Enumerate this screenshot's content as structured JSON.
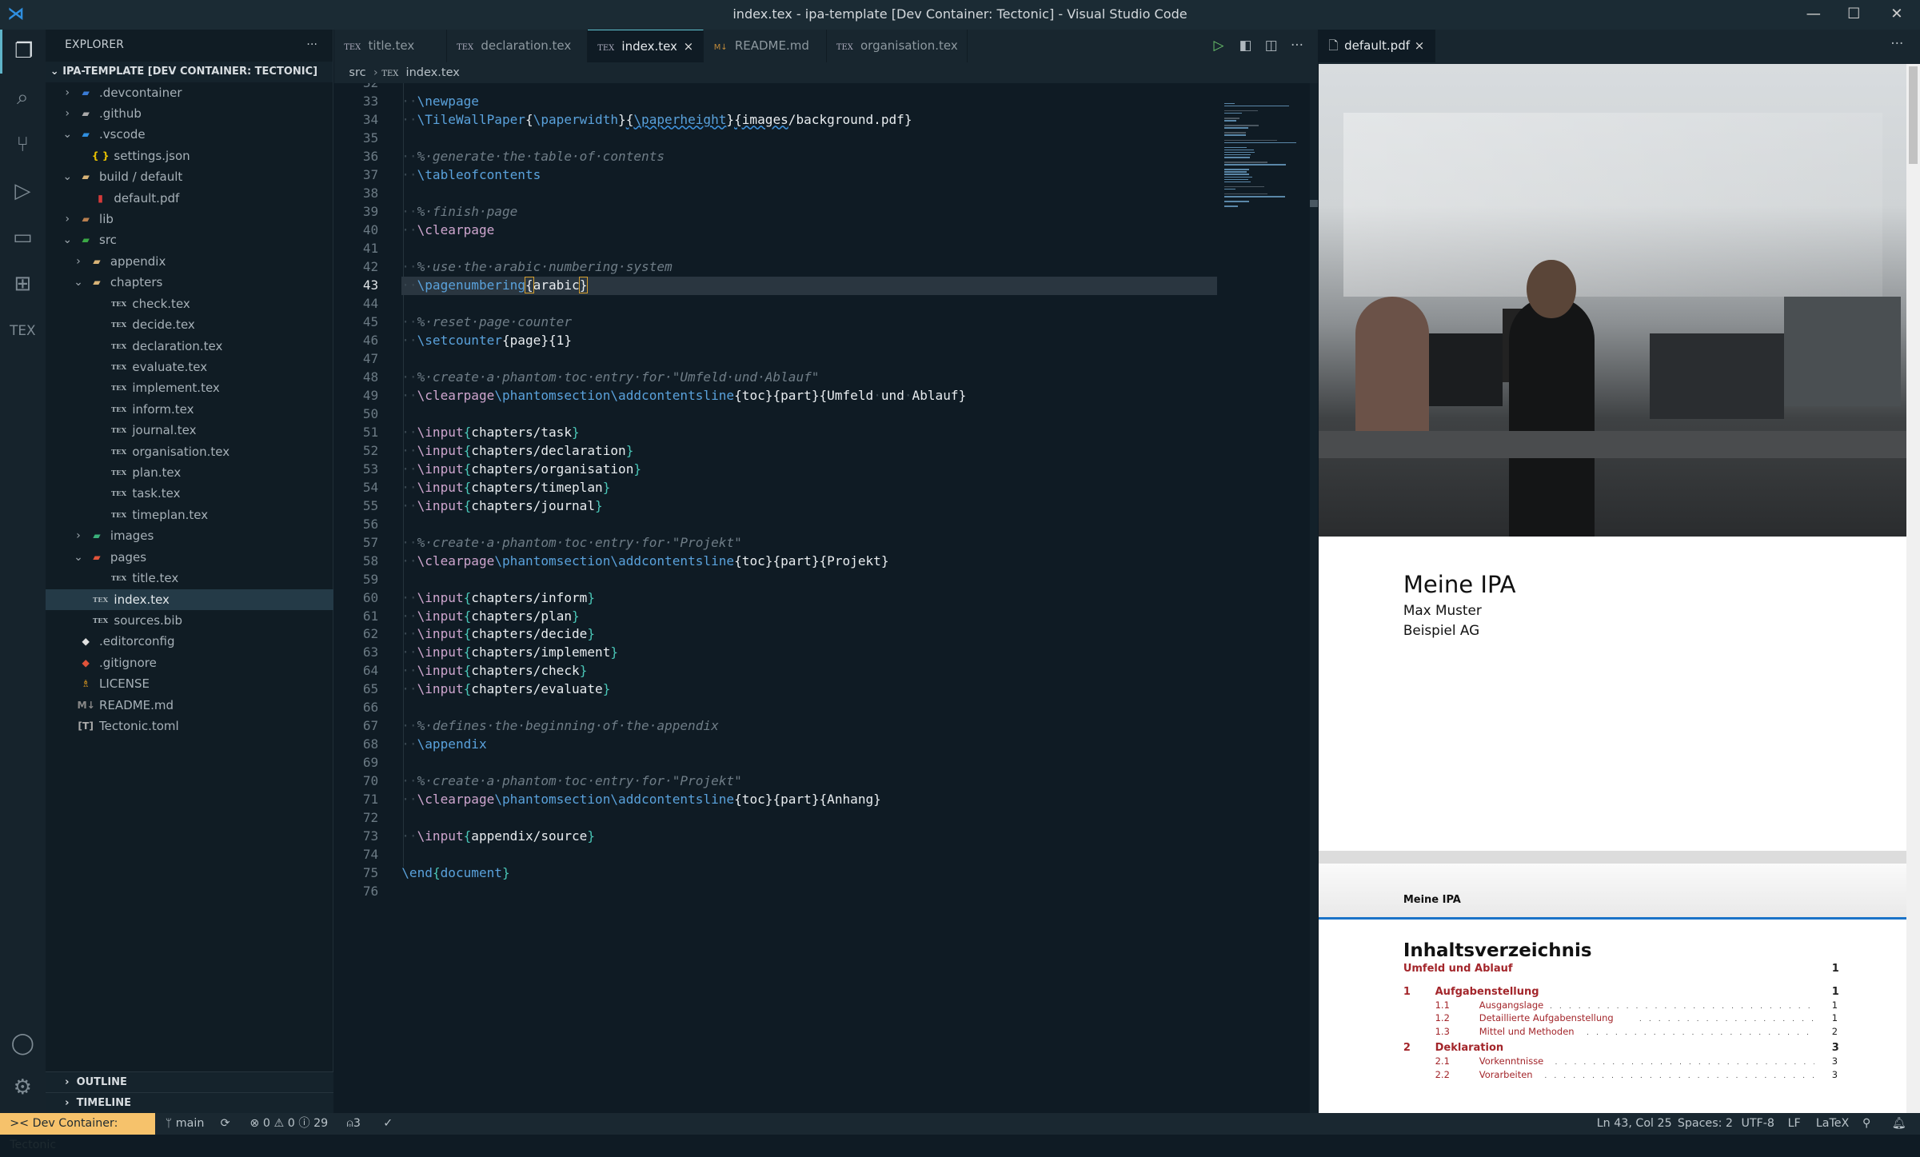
{
  "window": {
    "title": "index.tex - ipa-template [Dev Container: Tectonic] - Visual Studio Code"
  },
  "activity": [
    "files-icon",
    "search-icon",
    "source-control-icon",
    "run-debug-icon",
    "remote-explorer-icon",
    "extensions-icon",
    "tex-icon",
    "account-icon",
    "settings-gear-icon"
  ],
  "activity_tex_label": "TEX",
  "sidebar": {
    "title": "EXPLORER",
    "more": "···",
    "root": "IPA-TEMPLATE [DEV CONTAINER: TECTONIC]",
    "items": [
      {
        "label": ".devcontainer",
        "depth": 1,
        "chev": "right",
        "icon": "devcontainer-folder-icon",
        "color": "#3a7bd5"
      },
      {
        "label": ".github",
        "depth": 1,
        "chev": "right",
        "icon": "github-folder-icon",
        "color": "#aaaaaa"
      },
      {
        "label": ".vscode",
        "depth": 1,
        "chev": "down",
        "icon": "vscode-folder-icon",
        "color": "#2f8fe0"
      },
      {
        "label": "settings.json",
        "depth": 2,
        "icon": "json-icon",
        "color": "#e8c100",
        "glyph": "{ }"
      },
      {
        "label": "build / default",
        "depth": 1,
        "chev": "down",
        "icon": "folder-open-icon",
        "color": "#d8b377"
      },
      {
        "label": "default.pdf",
        "depth": 2,
        "icon": "pdf-icon",
        "color": "#d63a3a"
      },
      {
        "label": "lib",
        "depth": 1,
        "chev": "right",
        "icon": "lib-folder-icon",
        "color": "#b97f4f"
      },
      {
        "label": "src",
        "depth": 1,
        "chev": "down",
        "icon": "src-folder-icon",
        "color": "#3aa845"
      },
      {
        "label": "appendix",
        "depth": 2,
        "chev": "right",
        "icon": "folder-icon",
        "color": "#d8b377"
      },
      {
        "label": "chapters",
        "depth": 2,
        "chev": "down",
        "icon": "folder-open-icon",
        "color": "#d8b377"
      },
      {
        "label": "check.tex",
        "depth": 3,
        "icon": "tex-file-icon"
      },
      {
        "label": "decide.tex",
        "depth": 3,
        "icon": "tex-file-icon"
      },
      {
        "label": "declaration.tex",
        "depth": 3,
        "icon": "tex-file-icon"
      },
      {
        "label": "evaluate.tex",
        "depth": 3,
        "icon": "tex-file-icon"
      },
      {
        "label": "implement.tex",
        "depth": 3,
        "icon": "tex-file-icon"
      },
      {
        "label": "inform.tex",
        "depth": 3,
        "icon": "tex-file-icon"
      },
      {
        "label": "journal.tex",
        "depth": 3,
        "icon": "tex-file-icon"
      },
      {
        "label": "organisation.tex",
        "depth": 3,
        "icon": "tex-file-icon"
      },
      {
        "label": "plan.tex",
        "depth": 3,
        "icon": "tex-file-icon"
      },
      {
        "label": "task.tex",
        "depth": 3,
        "icon": "tex-file-icon"
      },
      {
        "label": "timeplan.tex",
        "depth": 3,
        "icon": "tex-file-icon"
      },
      {
        "label": "images",
        "depth": 2,
        "chev": "right",
        "icon": "images-folder-icon",
        "color": "#3ab07a"
      },
      {
        "label": "pages",
        "depth": 2,
        "chev": "down",
        "icon": "pages-folder-icon",
        "color": "#e0533a"
      },
      {
        "label": "title.tex",
        "depth": 3,
        "icon": "tex-file-icon"
      },
      {
        "label": "index.tex",
        "depth": 2,
        "icon": "tex-file-icon",
        "selected": true
      },
      {
        "label": "sources.bib",
        "depth": 2,
        "icon": "bib-file-icon"
      },
      {
        "label": ".editorconfig",
        "depth": 1,
        "icon": "editorconfig-icon",
        "color": "#e0e0e0"
      },
      {
        "label": ".gitignore",
        "depth": 1,
        "icon": "git-icon",
        "color": "#e0533a"
      },
      {
        "label": "LICENSE",
        "depth": 1,
        "icon": "license-icon",
        "color": "#e8a020"
      },
      {
        "label": "README.md",
        "depth": 1,
        "icon": "markdown-icon",
        "color": "#888888"
      },
      {
        "label": "Tectonic.toml",
        "depth": 1,
        "icon": "toml-icon",
        "color": "#aaaaaa"
      }
    ],
    "panels": [
      "OUTLINE",
      "TIMELINE"
    ]
  },
  "editor": {
    "tabs": [
      {
        "label": "title.tex",
        "icon": "tex-file-icon"
      },
      {
        "label": "declaration.tex",
        "icon": "tex-file-icon"
      },
      {
        "label": "index.tex",
        "icon": "tex-file-icon",
        "active": true
      },
      {
        "label": "README.md",
        "icon": "markdown-icon"
      },
      {
        "label": "organisation.tex",
        "icon": "tex-file-icon"
      }
    ],
    "tab_icon_text": "TEX",
    "md_icon_text": "M↓",
    "close": "×",
    "actions": [
      "run-icon",
      "open-preview-icon",
      "split-editor-icon",
      "more-icon"
    ],
    "breadcrumb": [
      "src",
      "index.tex"
    ],
    "first_line": 32,
    "current_line": 43,
    "lines": [
      [],
      [
        [
          "ws",
          "··"
        ],
        [
          "cmd",
          "\\newpage"
        ]
      ],
      [
        [
          "ws",
          "··"
        ],
        [
          "cmd",
          "\\TileWallPaper"
        ],
        [
          "br",
          "{"
        ],
        [
          "cmd",
          "\\paperwidth"
        ],
        [
          "br",
          "}"
        ],
        [
          "sq",
          "{"
        ],
        [
          "sqc",
          "\\paperheight"
        ],
        [
          "br",
          "}"
        ],
        [
          "sqt",
          "{images"
        ],
        [
          "txt",
          "/background.pdf}"
        ]
      ],
      [],
      [
        [
          "ws",
          "··"
        ],
        [
          "cm",
          "%·generate·the·table·of·contents"
        ]
      ],
      [
        [
          "ws",
          "··"
        ],
        [
          "cmd",
          "\\tableofcontents"
        ]
      ],
      [],
      [
        [
          "ws",
          "··"
        ],
        [
          "cm",
          "%·finish·page"
        ]
      ],
      [
        [
          "ws",
          "··"
        ],
        [
          "pink",
          "\\clearpage"
        ]
      ],
      [],
      [
        [
          "ws",
          "··"
        ],
        [
          "cm",
          "%·use·the·arabic·numbering·system"
        ]
      ],
      [
        [
          "ws",
          "··"
        ],
        [
          "cmd",
          "\\pagenumbering"
        ],
        [
          "bm",
          "{"
        ],
        [
          "txt",
          "arabic"
        ],
        [
          "bm",
          "}"
        ]
      ],
      [],
      [
        [
          "ws",
          "··"
        ],
        [
          "cm",
          "%·reset·page·counter"
        ]
      ],
      [
        [
          "ws",
          "··"
        ],
        [
          "cmd",
          "\\setcounter"
        ],
        [
          "txt",
          "{page}{1}"
        ]
      ],
      [],
      [
        [
          "ws",
          "··"
        ],
        [
          "cm",
          "%·create·a·phantom·toc·entry·for·\"Umfeld·und·Ablauf\""
        ]
      ],
      [
        [
          "ws",
          "··"
        ],
        [
          "pink",
          "\\clearpage"
        ],
        [
          "cmd",
          "\\phantomsection\\addcontentsline"
        ],
        [
          "txt",
          "{toc}{part}{Umfeld"
        ],
        [
          "ws",
          "·"
        ],
        [
          "txt",
          "und"
        ],
        [
          "ws",
          "·"
        ],
        [
          "txt",
          "Ablauf}"
        ]
      ],
      [],
      [
        [
          "ws",
          "··"
        ],
        [
          "pink",
          "\\input"
        ],
        [
          "tb",
          "{"
        ],
        [
          "txt",
          "chapters/task"
        ],
        [
          "tb",
          "}"
        ]
      ],
      [
        [
          "ws",
          "··"
        ],
        [
          "pink",
          "\\input"
        ],
        [
          "tb",
          "{"
        ],
        [
          "txt",
          "chapters/declaration"
        ],
        [
          "tb",
          "}"
        ]
      ],
      [
        [
          "ws",
          "··"
        ],
        [
          "pink",
          "\\input"
        ],
        [
          "tb",
          "{"
        ],
        [
          "txt",
          "chapters/organisation"
        ],
        [
          "tb",
          "}"
        ]
      ],
      [
        [
          "ws",
          "··"
        ],
        [
          "pink",
          "\\input"
        ],
        [
          "tb",
          "{"
        ],
        [
          "txt",
          "chapters/timeplan"
        ],
        [
          "tb",
          "}"
        ]
      ],
      [
        [
          "ws",
          "··"
        ],
        [
          "pink",
          "\\input"
        ],
        [
          "tb",
          "{"
        ],
        [
          "txt",
          "chapters/journal"
        ],
        [
          "tb",
          "}"
        ]
      ],
      [],
      [
        [
          "ws",
          "··"
        ],
        [
          "cm",
          "%·create·a·phantom·toc·entry·for·\"Projekt\""
        ]
      ],
      [
        [
          "ws",
          "··"
        ],
        [
          "pink",
          "\\clearpage"
        ],
        [
          "cmd",
          "\\phantomsection\\addcontentsline"
        ],
        [
          "txt",
          "{toc}{part}{Projekt}"
        ]
      ],
      [],
      [
        [
          "ws",
          "··"
        ],
        [
          "pink",
          "\\input"
        ],
        [
          "tb",
          "{"
        ],
        [
          "txt",
          "chapters/inform"
        ],
        [
          "tb",
          "}"
        ]
      ],
      [
        [
          "ws",
          "··"
        ],
        [
          "pink",
          "\\input"
        ],
        [
          "tb",
          "{"
        ],
        [
          "txt",
          "chapters/plan"
        ],
        [
          "tb",
          "}"
        ]
      ],
      [
        [
          "ws",
          "··"
        ],
        [
          "pink",
          "\\input"
        ],
        [
          "tb",
          "{"
        ],
        [
          "txt",
          "chapters/decide"
        ],
        [
          "tb",
          "}"
        ]
      ],
      [
        [
          "ws",
          "··"
        ],
        [
          "pink",
          "\\input"
        ],
        [
          "tb",
          "{"
        ],
        [
          "txt",
          "chapters/implement"
        ],
        [
          "tb",
          "}"
        ]
      ],
      [
        [
          "ws",
          "··"
        ],
        [
          "pink",
          "\\input"
        ],
        [
          "tb",
          "{"
        ],
        [
          "txt",
          "chapters/check"
        ],
        [
          "tb",
          "}"
        ]
      ],
      [
        [
          "ws",
          "··"
        ],
        [
          "pink",
          "\\input"
        ],
        [
          "tb",
          "{"
        ],
        [
          "txt",
          "chapters/evaluate"
        ],
        [
          "tb",
          "}"
        ]
      ],
      [],
      [
        [
          "ws",
          "··"
        ],
        [
          "cm",
          "%·defines·the·beginning·of·the·appendix"
        ]
      ],
      [
        [
          "ws",
          "··"
        ],
        [
          "cmd",
          "\\appendix"
        ]
      ],
      [],
      [
        [
          "ws",
          "··"
        ],
        [
          "cm",
          "%·create·a·phantom·toc·entry·for·\"Projekt\""
        ]
      ],
      [
        [
          "ws",
          "··"
        ],
        [
          "pink",
          "\\clearpage"
        ],
        [
          "cmd",
          "\\phantomsection\\addcontentsline"
        ],
        [
          "txt",
          "{toc}{part}{Anhang}"
        ]
      ],
      [],
      [
        [
          "ws",
          "··"
        ],
        [
          "pink",
          "\\input"
        ],
        [
          "tb",
          "{"
        ],
        [
          "txt",
          "appendix/source"
        ],
        [
          "tb",
          "}"
        ]
      ],
      [],
      [
        [
          "cmd",
          "\\end"
        ],
        [
          "tb",
          "{"
        ],
        [
          "cmd",
          "document"
        ],
        [
          "tb",
          "}"
        ]
      ],
      []
    ]
  },
  "pdf": {
    "tab": "default.pdf",
    "close": "×",
    "more": "···",
    "title_page": {
      "title": "Meine IPA",
      "author": "Max Muster",
      "company": "Beispiel AG"
    },
    "header": "Meine IPA",
    "toc_title": "Inhaltsverzeichnis",
    "toc": [
      {
        "kind": "part",
        "title": "Umfeld und Ablauf",
        "page": "1"
      },
      {
        "kind": "chapter",
        "num": "1",
        "title": "Aufgabenstellung",
        "page": "1"
      },
      {
        "kind": "section",
        "num": "1.1",
        "title": "Ausgangslage",
        "page": "1"
      },
      {
        "kind": "section",
        "num": "1.2",
        "title": "Detaillierte Aufgabenstellung",
        "page": "1"
      },
      {
        "kind": "section",
        "num": "1.3",
        "title": "Mittel und Methoden",
        "page": "2"
      },
      {
        "kind": "chapter",
        "num": "2",
        "title": "Deklaration",
        "page": "3"
      },
      {
        "kind": "section",
        "num": "2.1",
        "title": "Vorkenntnisse",
        "page": "3"
      },
      {
        "kind": "section",
        "num": "2.2",
        "title": "Vorarbeiten",
        "page": "3"
      }
    ],
    "toc_color": "#a3262b"
  },
  "status": {
    "remote": "Dev Container: Tectonic",
    "branch": "main",
    "errors": "0",
    "warnings": "0",
    "infos": "29",
    "ports": "3",
    "position": "Ln 43, Col 25",
    "spaces": "Spaces: 2",
    "encoding": "UTF-8",
    "eol": "LF",
    "language": "LaTeX",
    "remote_color": "#f6c26b"
  }
}
